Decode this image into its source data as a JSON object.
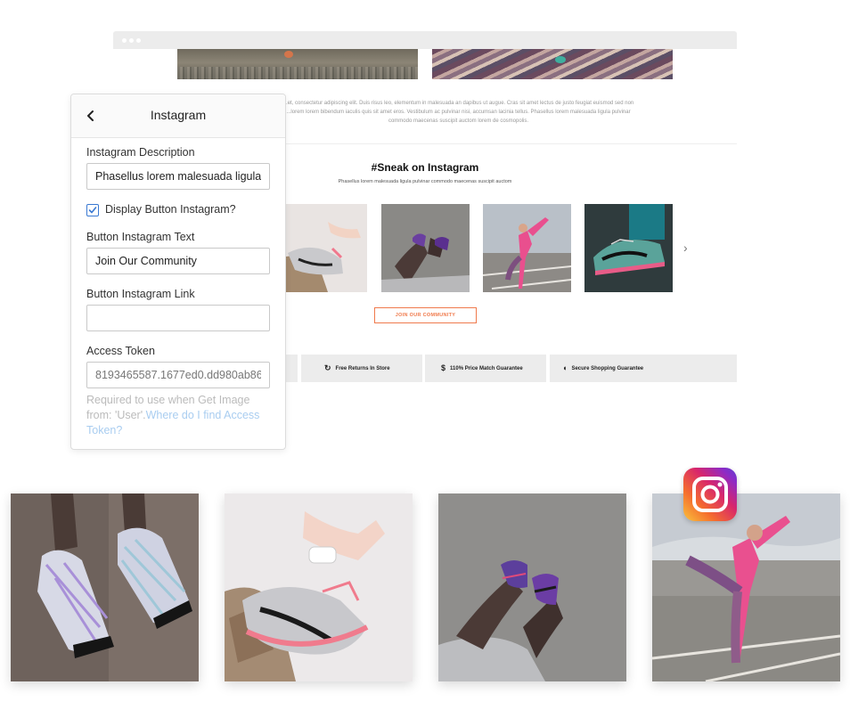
{
  "preview": {
    "hero_dots": "● ○ ○",
    "lorem": "...et, consectetur adipiscing elit. Duis risus leo, elementum in malesuada an dapibus ut augue. Cras sit amet lectus de justo feugiat euismod sed non ...lorem lorem bibendum iaculis quis sit amet eros. Vestibulum ac pulvinar nisi, accumsan lacinia tellus. Phasellus lorem malesuada ligula pulvinar commodo maecenas suscipit auctom lorem de cosmopolis.",
    "sneak_title": "#Sneak on Instagram",
    "sneak_subtitle": "Phasellus lorem malesuada ligula pulvinar commodo maecenas suscipit auctom",
    "join_button": "JOIN OUR COMMUNITY",
    "features": [
      {
        "icon": "refresh-icon",
        "glyph": "↻",
        "label": "Free Returns In Store"
      },
      {
        "icon": "dollar-icon",
        "glyph": "$",
        "label": "110% Price Match Guarantee"
      },
      {
        "icon": "shield-icon",
        "glyph": "◖",
        "label": "Secure Shopping Guarantee"
      }
    ]
  },
  "panel": {
    "title": "Instagram",
    "description_label": "Instagram Description",
    "description_value": "Phasellus lorem malesuada ligula",
    "display_button_label": "Display Button Instagram?",
    "display_button_checked": true,
    "button_text_label": "Button Instagram Text",
    "button_text_value": "Join Our Community",
    "button_link_label": "Button Instagram Link",
    "button_link_value": "",
    "access_token_label": "Access Token",
    "access_token_value": "8193465587.1677ed0.dd980ab86",
    "help_text": "Required to use when Get Image from: 'User'.",
    "help_link": "Where do I find Access Token?"
  },
  "colors": {
    "accent": "#f07a4c",
    "checkbox_blue": "#3a79d2",
    "link": "#a9cdf0"
  }
}
